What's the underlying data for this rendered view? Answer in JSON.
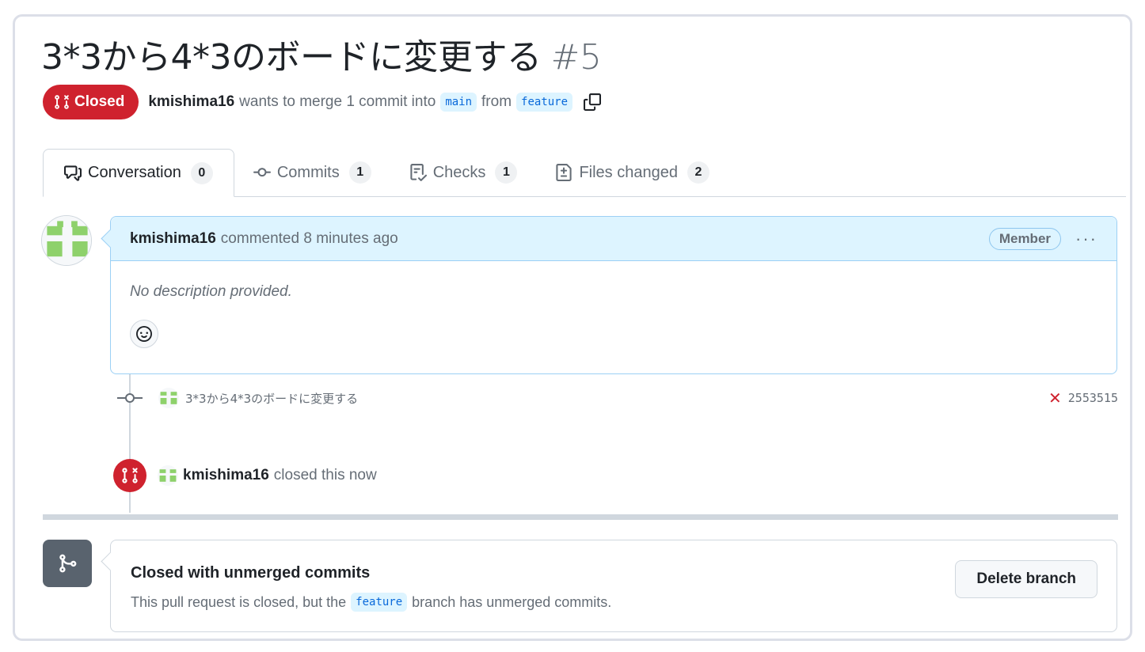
{
  "pr": {
    "title": "3*3から4*3のボードに変更する",
    "number": "#5",
    "state": "Closed",
    "author": "kmishima16",
    "merge_text": "wants to merge 1 commit into",
    "base_branch": "main",
    "from_text": "from",
    "head_branch": "feature"
  },
  "tabs": [
    {
      "label": "Conversation",
      "count": "0",
      "icon": "comment-discussion-icon"
    },
    {
      "label": "Commits",
      "count": "1",
      "icon": "git-commit-icon"
    },
    {
      "label": "Checks",
      "count": "1",
      "icon": "checklist-icon"
    },
    {
      "label": "Files changed",
      "count": "2",
      "icon": "file-diff-icon"
    }
  ],
  "comment": {
    "author": "kmishima16",
    "action": "commented 8 minutes ago",
    "role": "Member",
    "more": "···",
    "body": "No description provided."
  },
  "commit": {
    "message": "3*3から4*3のボードに変更する",
    "status": "✕",
    "sha": "2553515"
  },
  "closed_event": {
    "author": "kmishima16",
    "text": "closed this now"
  },
  "merge_box": {
    "title": "Closed with unmerged commits",
    "text_before": "This pull request is closed, but the",
    "branch": "feature",
    "text_after": "branch has unmerged commits.",
    "button": "Delete branch"
  },
  "colors": {
    "closed_red": "#cf222e",
    "link_blue": "#0969da",
    "header_bg": "#ddf4ff",
    "identicon_green": "#8ed16b"
  }
}
